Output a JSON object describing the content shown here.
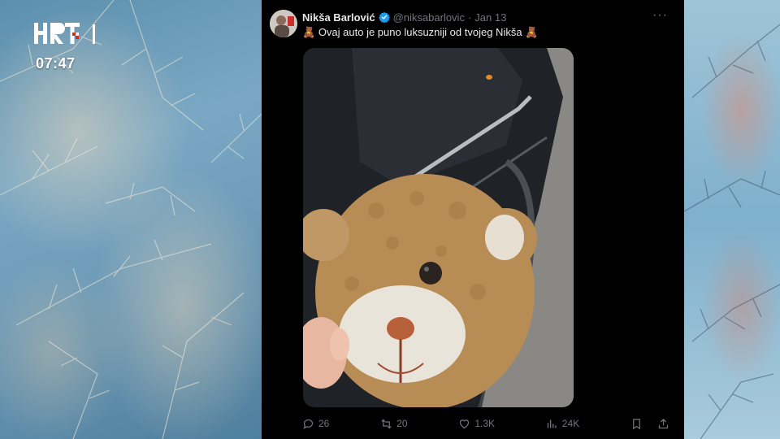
{
  "overlay": {
    "logo_text": "HRT",
    "channel_number": "1",
    "time": "07:47"
  },
  "tweet": {
    "display_name": "Nikša Barlović",
    "handle": "@niksabarlovic",
    "separator": "·",
    "date": "Jan 13",
    "more_label": "···",
    "text_prefix_emoji": "🧸",
    "text": "Ovaj auto je puno luksuzniji od tvojeg Nikša",
    "text_suffix_emoji": "🧸",
    "verified": true,
    "media_icon": "teddy-bear-car-photo",
    "actions": {
      "replies": "26",
      "reposts": "20",
      "likes": "1.3K",
      "views": "24K"
    }
  },
  "colors": {
    "card_bg": "#000000",
    "text_primary": "#e7e9ea",
    "text_secondary": "#71767b",
    "verified_blue": "#1d9bf0",
    "hrt_red": "#e2231a"
  }
}
